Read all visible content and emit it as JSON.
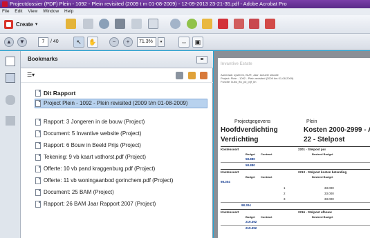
{
  "window": {
    "title": "Projectdossier (PDF) Plein - 1092 - Plein revisited (2009 t m 01-08-2009) - 12-09-2013 23-21-35.pdf - Adobe Acrobat Pro"
  },
  "menu": [
    "File",
    "Edit",
    "View",
    "Window",
    "Help"
  ],
  "toolbar": {
    "create_label": "Create"
  },
  "nav": {
    "page_current": "7",
    "page_total": "/ 40",
    "zoom": "71.3%"
  },
  "bookmarks": {
    "title": "Bookmarks",
    "items": [
      {
        "label": "Dit Rapport"
      },
      {
        "label": "Project Plein - 1092 - Plein revisited (2009 t/m 01-08-2009)"
      },
      {
        "label": "Rapport: 3 Jongeren in de bouw (Project)"
      },
      {
        "label": "Document: 5 Invantive website (Project)"
      },
      {
        "label": "Rapport: 6 Bouw in Beeld Prijs (Project)"
      },
      {
        "label": "Tekening: 9 vb kaart vathorst.pdf (Project)"
      },
      {
        "label": "Offerte: 10 vb pand kraggenburg.pdf (Project)"
      },
      {
        "label": "Offerte: 11 vb woningaanbod gorinchem.pdf (Project)"
      },
      {
        "label": "Document: 25 BAM (Project)"
      },
      {
        "label": "Rapport: 26 BAM Jaar Rapport 2007 (Project)"
      }
    ]
  },
  "document": {
    "header": "Invantive Estate",
    "meta": [
      "Aanmaak: systeem, BUR, Jaar: Actuele situatie",
      "Project: Plein - 1092 - Plein revisited (2009 t/m 01-08-2009)",
      "Functie: kubo_ffa_pd_prjf_kh"
    ],
    "projectgegevens": "Projectgegevens",
    "plein": "Plein",
    "hoofd_left": "Hoofdverdichting",
    "hoofd_right": "Kosten 2000-2999 - A",
    "verd_left": "Verdichting",
    "verd_right": "22 - Stelpost",
    "kostensoort": "Kostensoort",
    "cost1": "2201 - Stelpost pui",
    "cost2": "2213 - Stelpost kosten betending",
    "cost3": "2216 - Stelpost afbouw",
    "col_budget": "Budget",
    "col_contract": "Contract",
    "col_besteed": "Besteed Budget",
    "val1": "58.880",
    "val1b": "58.880",
    "val2": "98.304",
    "rows": [
      {
        "n": "1",
        "b": "33.000"
      },
      {
        "n": "2",
        "b": "33.000"
      },
      {
        "n": "3",
        "b": "33.000"
      }
    ],
    "val2b": "98.304",
    "val3": "219.392",
    "val3b": "219.392"
  }
}
